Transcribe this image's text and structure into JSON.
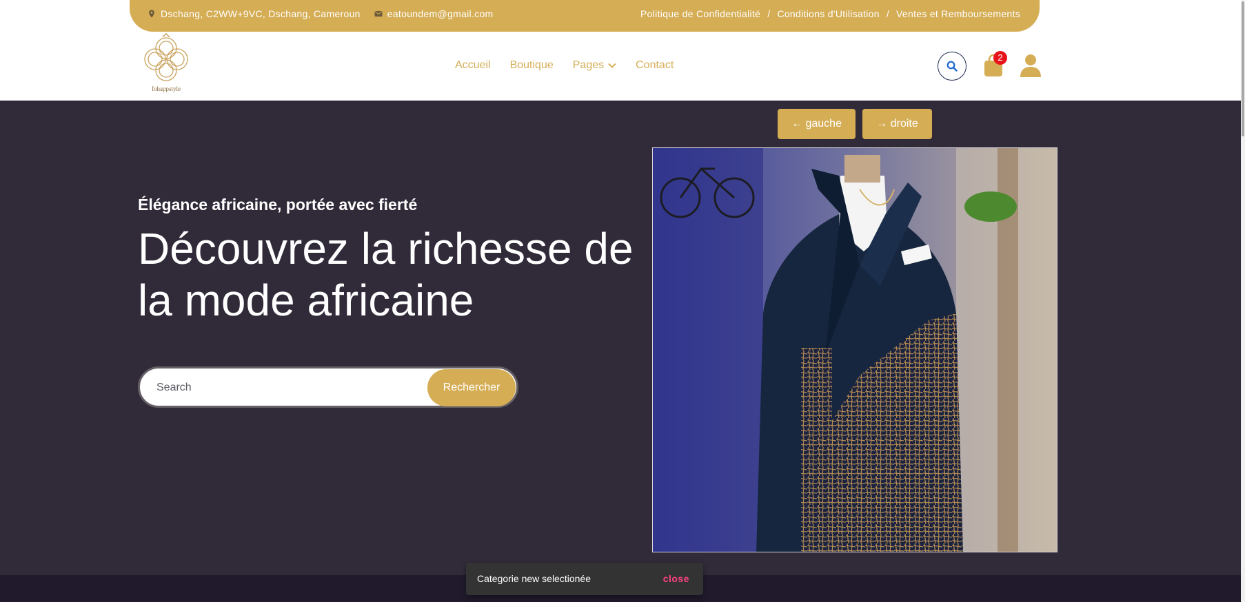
{
  "topbar": {
    "address": "Dschang, C2WW+9VC, Dschang, Cameroun",
    "email": "eatoundem@gmail.com",
    "links": [
      "Politique de Confidentialité",
      "Conditions d'Utilisation",
      "Ventes et Remboursements"
    ],
    "separator": "/"
  },
  "logo": {
    "brand": "fohappstyle"
  },
  "nav": {
    "items": [
      "Accueil",
      "Boutique",
      "Pages",
      "Contact"
    ]
  },
  "cart": {
    "count": "2"
  },
  "hero": {
    "subtitle": "Élégance africaine, portée avec fierté",
    "title": "Découvrez la richesse de la mode africaine",
    "search_placeholder": "Search",
    "search_button": "Rechercher",
    "prev_button": "← gauche",
    "next_button": "→ droite"
  },
  "toast": {
    "message": "Categorie new selectionée",
    "action": "close"
  },
  "colors": {
    "accent": "#d5ad55",
    "hero_bg": "#312a39",
    "badge": "#e8141b",
    "toast_action": "#ff4081"
  }
}
